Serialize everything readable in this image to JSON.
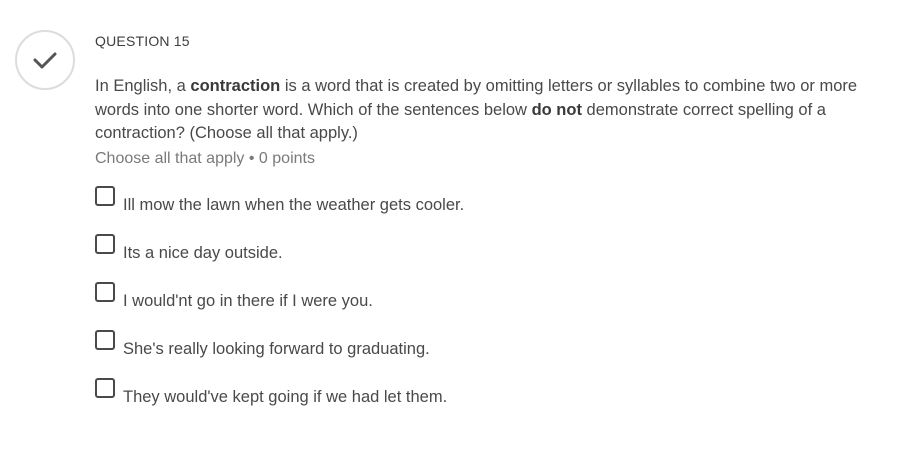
{
  "question": {
    "number_label": "QUESTION 15",
    "prompt": {
      "part1": "In English, a ",
      "bold1": "contraction",
      "part2": " is a word that is created by omitting letters or syllables to combine two or more words into one shorter word. Which of the sentences below ",
      "bold2": "do not",
      "part3": " demonstrate correct spelling of a contraction? (Choose all that apply.)"
    },
    "meta": "Choose all that apply • 0 points",
    "status_icon": "checkmark-icon",
    "options": [
      {
        "label": "Ill mow the lawn when the weather gets cooler.",
        "checked": false
      },
      {
        "label": "Its a nice day outside.",
        "checked": false
      },
      {
        "label": "I would'nt go in there if I were you.",
        "checked": false
      },
      {
        "label": "She's really looking forward to graduating.",
        "checked": false
      },
      {
        "label": "They would've kept going if we had let them.",
        "checked": false
      }
    ]
  }
}
